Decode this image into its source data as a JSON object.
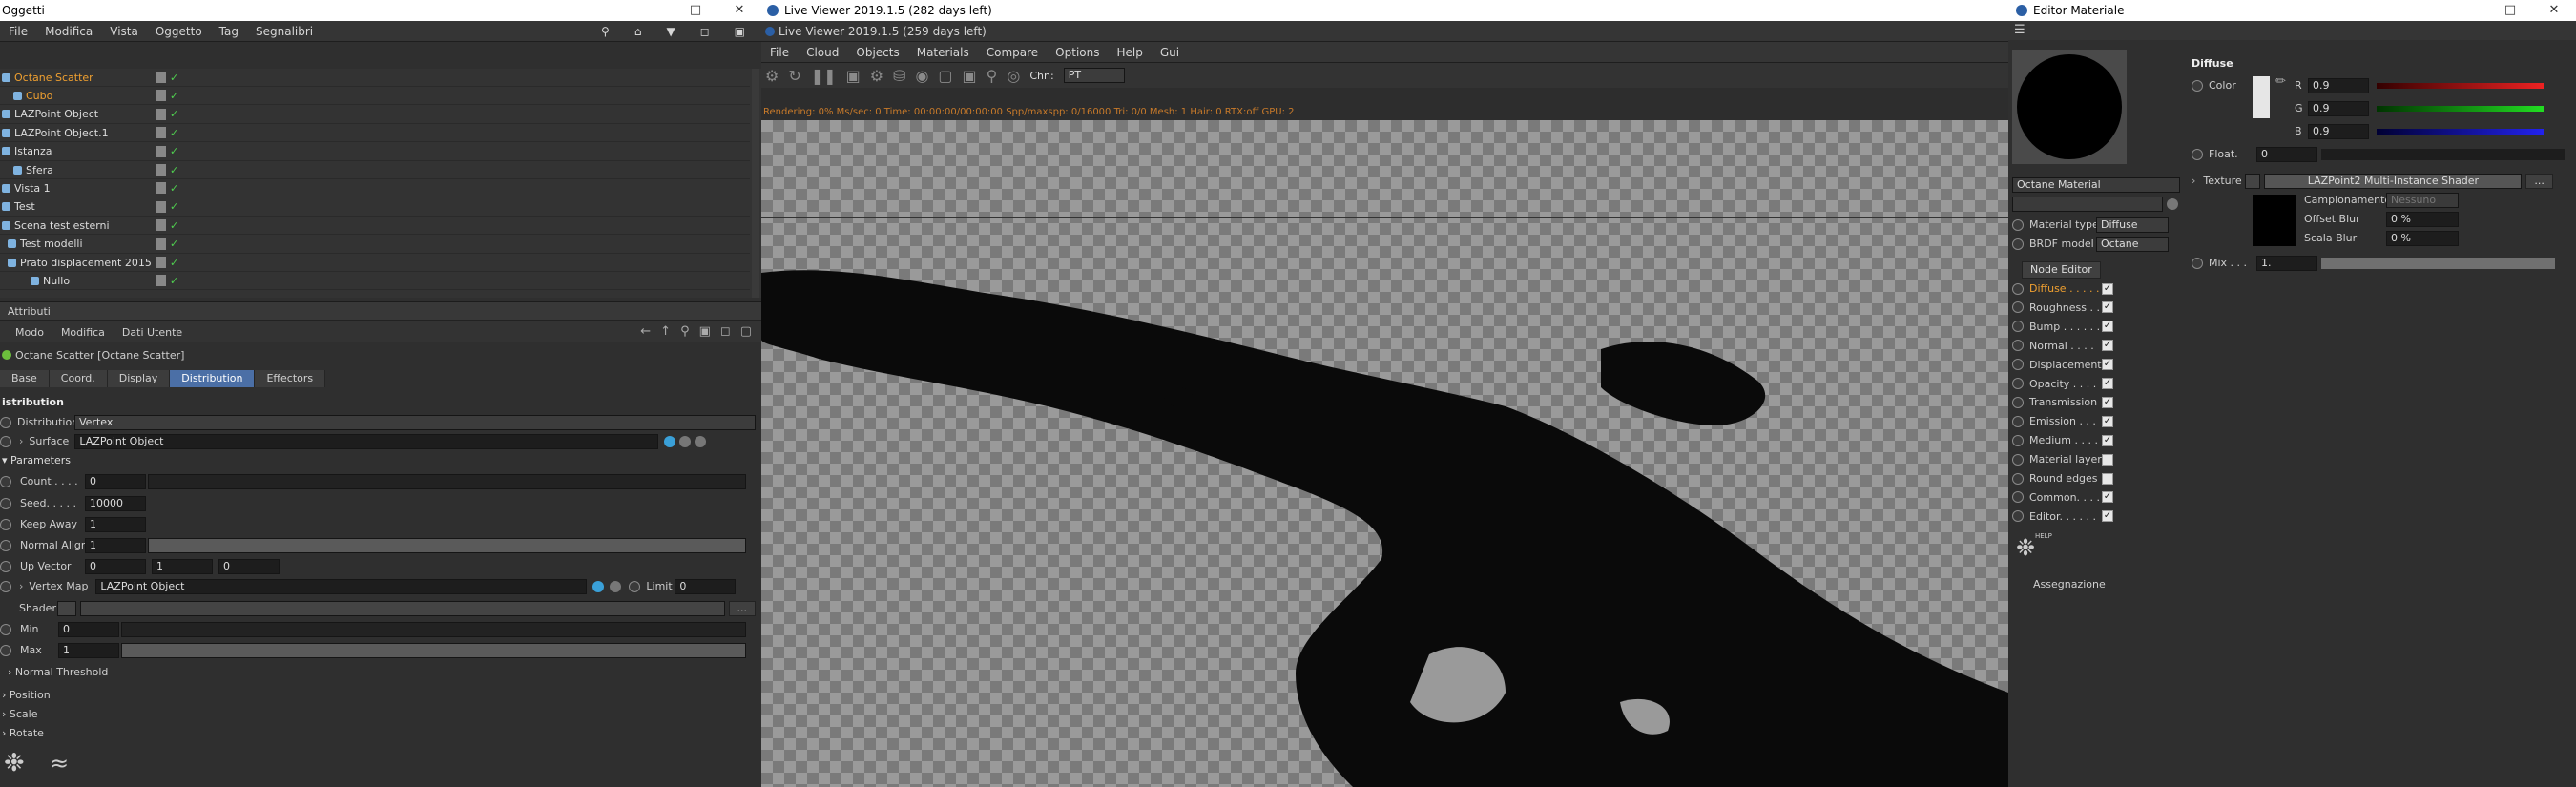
{
  "left": {
    "title": "Oggetti",
    "menu": [
      "File",
      "Modifica",
      "Vista",
      "Oggetto",
      "Tag",
      "Segnalibri"
    ],
    "objects": [
      {
        "name": "Octane Scatter",
        "color": "#f0a030",
        "indent": 0,
        "icon": "scatter-icon"
      },
      {
        "name": "Cubo",
        "color": "#f0a030",
        "indent": 12,
        "icon": "cube-icon"
      },
      {
        "name": "LAZPoint Object",
        "color": "#ddd",
        "indent": 0,
        "icon": "point-icon"
      },
      {
        "name": "LAZPoint Object.1",
        "color": "#ddd",
        "indent": 0,
        "icon": "point-icon"
      },
      {
        "name": "Istanza",
        "color": "#ddd",
        "indent": 0,
        "icon": "instance-icon"
      },
      {
        "name": "Sfera",
        "color": "#ddd",
        "indent": 12,
        "icon": "sphere-icon"
      },
      {
        "name": "Vista 1",
        "color": "#ddd",
        "indent": 0,
        "icon": "view-icon"
      },
      {
        "name": "Test",
        "color": "#ddd",
        "indent": 0,
        "icon": "null-icon"
      },
      {
        "name": "Scena test esterni",
        "color": "#ddd",
        "indent": 0,
        "icon": "null-icon"
      },
      {
        "name": "Test modelli",
        "color": "#ddd",
        "indent": 6,
        "icon": "null-icon"
      },
      {
        "name": "Prato displacement 2015",
        "color": "#ddd",
        "indent": 6,
        "icon": "null-icon"
      },
      {
        "name": "Nullo",
        "color": "#ddd",
        "indent": 30,
        "icon": "null-icon"
      }
    ],
    "attr_title": "Attributi",
    "attr_menu": [
      "Modo",
      "Modifica",
      "Dati Utente"
    ],
    "object_label": "Octane Scatter [Octane Scatter]",
    "tabs": [
      "Base",
      "Coord.",
      "Display",
      "Distribution",
      "Effectors"
    ],
    "active_tab": "Distribution",
    "section": "istribution",
    "distribution_label": "Distribution",
    "distribution_value": "Vertex",
    "surface_label": "Surface",
    "surface_value": "LAZPoint Object",
    "params_label": "Parameters",
    "count_label": "Count . . . .",
    "count_value": "0",
    "seed_label": "Seed. . . . .",
    "seed_value": "10000",
    "keepaway_label": "Keep Away",
    "keepaway_value": "1",
    "normalalign_label": "Normal Align",
    "normalalign_value": "1",
    "upvector_label": "Up Vector",
    "upvector_values": [
      "0",
      "1",
      "0"
    ],
    "vertexmap_label": "Vertex Map",
    "vertexmap_value": "LAZPoint Object",
    "limit_label": "Limit",
    "limit_value": "0",
    "shader_label": "Shader",
    "min_label": "Min",
    "min_value": "0",
    "max_label": "Max",
    "max_value": "1",
    "normal_threshold": "Normal Threshold",
    "position": "Position",
    "scale": "Scale",
    "rotate": "Rotate"
  },
  "viewer": {
    "title": "Live Viewer 2019.1.5 (282 days left)",
    "title2": "Live Viewer 2019.1.5 (259 days left)",
    "menu": [
      "File",
      "Cloud",
      "Objects",
      "Materials",
      "Compare",
      "Options",
      "Help",
      "Gui"
    ],
    "chn_label": "Chn:",
    "chn_value": "PT",
    "status": "Rendering: 0% Ms/sec: 0 Time: 00:00:00/00:00:00 Spp/maxspp: 0/16000 Tri: 0/0 Mesh: 1 Hair: 0 RTX:off GPU: 2",
    "status_color": "#c87a2a"
  },
  "material": {
    "title": "Editor Materiale",
    "name": "Octane Material",
    "material_type_label": "Material type",
    "material_type": "Diffuse",
    "brdf_label": "BRDF model",
    "brdf": "Octane",
    "node_editor": "Node Editor",
    "channels": [
      {
        "label": "Diffuse . . . . .",
        "checked": true,
        "active": true
      },
      {
        "label": "Roughness . .",
        "checked": true,
        "active": false
      },
      {
        "label": "Bump . . . . . .",
        "checked": true,
        "active": false
      },
      {
        "label": "Normal . . . .",
        "checked": true,
        "active": false
      },
      {
        "label": "Displacement",
        "checked": true,
        "active": false
      },
      {
        "label": "Opacity . . . .",
        "checked": true,
        "active": false
      },
      {
        "label": "Transmission",
        "checked": true,
        "active": false
      },
      {
        "label": "Emission . . .",
        "checked": true,
        "active": false
      },
      {
        "label": "Medium . . . .",
        "checked": true,
        "active": false
      },
      {
        "label": "Material layer",
        "checked": false,
        "active": false
      },
      {
        "label": "Round edges",
        "checked": false,
        "active": false
      },
      {
        "label": "Common. . . .",
        "checked": true,
        "active": false
      },
      {
        "label": "Editor. . . . . .",
        "checked": true,
        "active": false
      }
    ],
    "help": "HELP",
    "assegnazione": "Assegnazione",
    "section": "Diffuse",
    "color_label": "Color",
    "r_label": "R",
    "r_value": "0.9",
    "g_label": "G",
    "g_value": "0.9",
    "b_label": "B",
    "b_value": "0.9",
    "float_label": "Float.",
    "float_value": "0",
    "texture_label": "Texture",
    "texture_value": "LAZPoint2 Multi-Instance Shader",
    "campionamento_label": "Campionamento",
    "campionamento_value": "Nessuno",
    "offset_label": "Offset Blur",
    "offset_value": "0 %",
    "scala_label": "Scala Blur",
    "scala_value": "0 %",
    "mix_label": "Mix . . .",
    "mix_value": "1."
  }
}
